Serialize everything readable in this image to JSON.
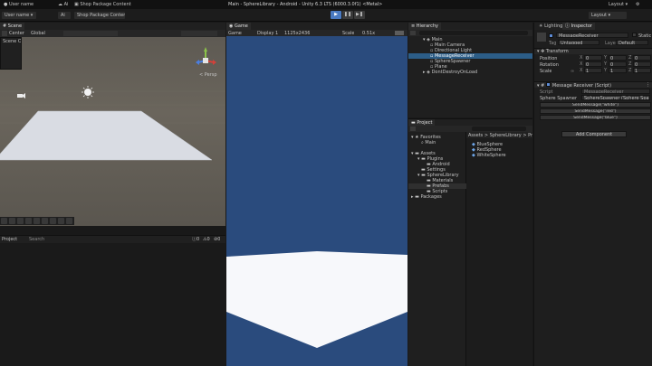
{
  "window": {
    "title": "Main - SphereLibrary - Android - Unity 6.3 LTS (6000.3.0f1) <Metal>",
    "account": "User name",
    "layout": "Layout"
  },
  "toolbar": {
    "package_label": "Shop Package Content",
    "cloud_label": "Ai",
    "play_icon": "▶",
    "pause_icon": "❚❚",
    "step_icon": "▶❚"
  },
  "scene": {
    "tab_label": "Scene",
    "options_label": "Scene Options",
    "persp_label": "< Persp",
    "toolbar_left": "Center",
    "toolbar_right": "Global",
    "handle_colors": {
      "x": "#d3413a",
      "y": "#8bc34a",
      "z": "#4b7ee0"
    }
  },
  "console": {
    "tab_label": "Project",
    "search_label": "Search",
    "counts": [
      "0",
      "0",
      "0"
    ]
  },
  "game": {
    "tab_label": "Game",
    "display_label": "Game",
    "screen_label": "Display 1",
    "res_label": "1125x2436",
    "scale_label": "Scale",
    "scale_value": "0.51x",
    "sky_color": "#2a4b7d",
    "ground_color": "#f7f8fb"
  },
  "hierarchy": {
    "tab_label": "Hierarchy",
    "items": [
      {
        "label": "Main",
        "indent": 0,
        "expanded": true,
        "selected": false
      },
      {
        "label": "Main Camera",
        "indent": 1,
        "selected": false
      },
      {
        "label": "Directional Light",
        "indent": 1,
        "selected": false
      },
      {
        "label": "MessageReceiver",
        "indent": 1,
        "selected": true
      },
      {
        "label": "SphereSpawner",
        "indent": 1,
        "selected": false
      },
      {
        "label": "Plane",
        "indent": 1,
        "selected": false
      },
      {
        "label": "DontDestroyOnLoad",
        "indent": 0,
        "expanded": true,
        "selected": false
      }
    ]
  },
  "project": {
    "tab_label": "Project",
    "favorites_label": "Favorites",
    "favorites": [
      "Main"
    ],
    "assets_label": "Assets",
    "tree": [
      {
        "label": "Plugins",
        "indent": 1
      },
      {
        "label": "Android",
        "indent": 2
      },
      {
        "label": "Settings",
        "indent": 1
      },
      {
        "label": "SphereLibrary",
        "indent": 1
      },
      {
        "label": "Materials",
        "indent": 2
      },
      {
        "label": "Prefabs",
        "indent": 2
      },
      {
        "label": "Scripts",
        "indent": 2
      },
      {
        "label": "Packages",
        "indent": 0
      }
    ],
    "breadcrumb": "Assets > SphereLibrary > Prefabs",
    "files": [
      "BlueSphere",
      "RedSphere",
      "WhiteSphere"
    ]
  },
  "inspector": {
    "tabs": [
      "Lighting",
      "Inspector"
    ],
    "object_name": "MessageReceiver",
    "static_label": "Static",
    "tag_label": "Tag",
    "tag_value": "Untagged",
    "layer_label": "Layer",
    "layer_value": "Default",
    "transform_label": "Transform",
    "position_label": "Position",
    "rotation_label": "Rotation",
    "scale_label": "Scale",
    "position": [
      "0",
      "0",
      "0"
    ],
    "rotation": [
      "0",
      "0",
      "0"
    ],
    "scale": [
      "1",
      "1",
      "1"
    ],
    "script_component": "Message Receiver (Script)",
    "script_label": "Script",
    "script_value": "MessageReceiver",
    "spawner_label": "Sphere Spawner",
    "spawner_value": "SphereSpawner (Sphere Spawner)",
    "buttons": [
      "SendMessage(\"white\")",
      "SendMessage(\"red\")",
      "SendMessage(\"blue\")"
    ],
    "add_component": "Add Component"
  }
}
